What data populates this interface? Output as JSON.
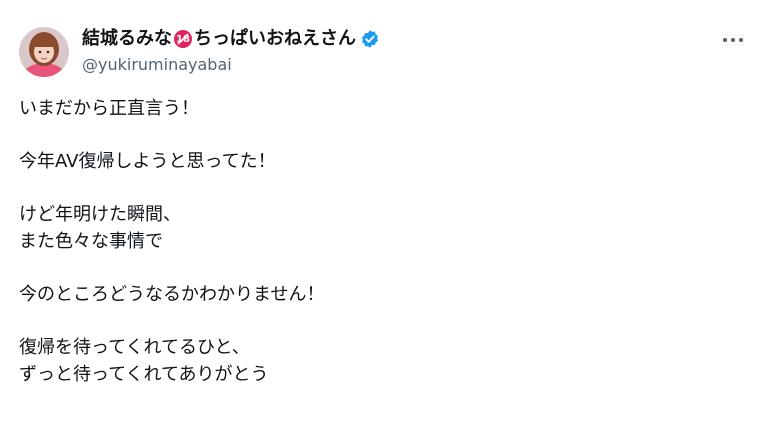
{
  "post": {
    "author": {
      "display_name_part1": "結城るみな",
      "age_badge": "18",
      "display_name_part2": "ちっぱいおねえさん",
      "handle": "@yukiruminayabai",
      "verified_icon": "verified-badge-icon",
      "avatar_icon": "avatar-photo"
    },
    "more_icon": "more-options-icon",
    "paragraphs": [
      [
        "いまだから正直言う！"
      ],
      [
        "今年AV復帰しようと思ってた！"
      ],
      [
        "けど年明けた瞬間、",
        "また色々な事情で"
      ],
      [
        "今のところどうなるかわかりません！"
      ],
      [
        "復帰を待ってくれてるひと、",
        "ずっと待ってくれてありがとう"
      ]
    ]
  },
  "colors": {
    "text_primary": "#0f1419",
    "text_secondary": "#536471",
    "verified_blue": "#1d9bf0",
    "badge_red": "#e0245e"
  }
}
